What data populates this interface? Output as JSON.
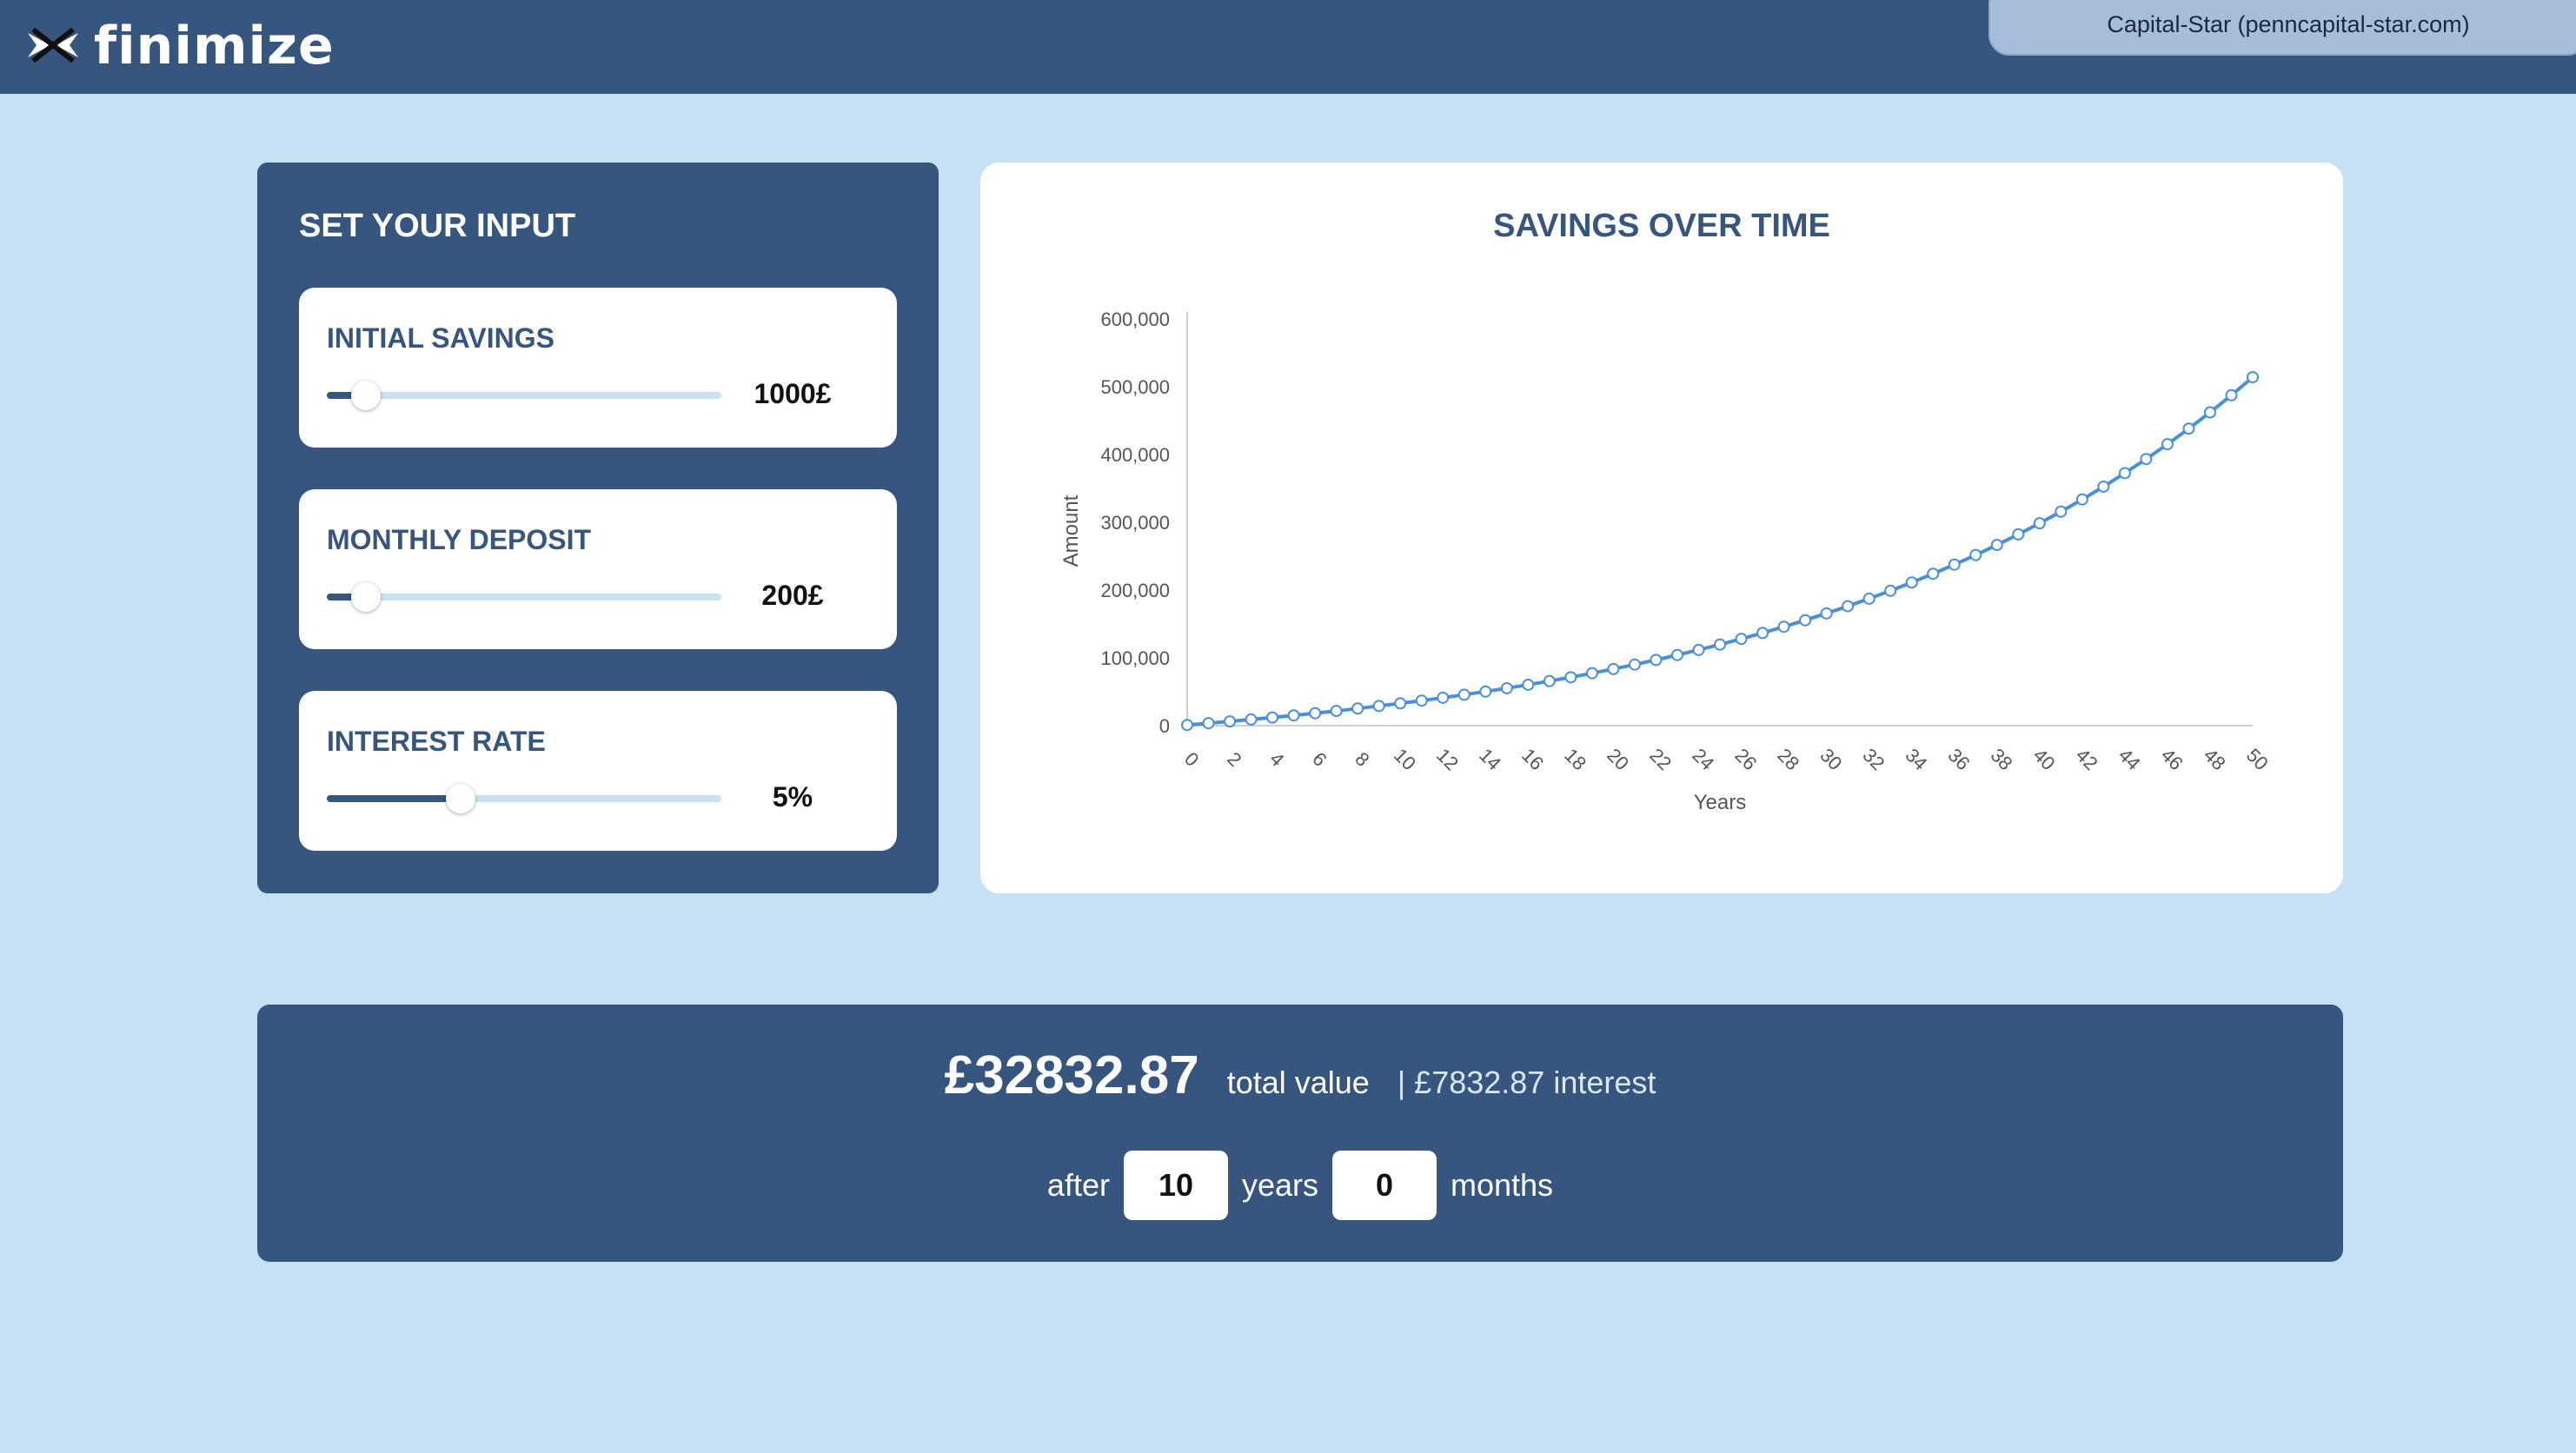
{
  "header": {
    "logo_text": "finimize",
    "logo_icon": "finimize-logo-icon",
    "notice_text": "Capital-Star (penncapital-star.com)"
  },
  "colors": {
    "header_bg": "#36557f",
    "page_bg": "#c6e1f5",
    "accent": "#36557f",
    "line": "#4a90d9"
  },
  "input_panel": {
    "title": "SET YOUR INPUT",
    "controls": [
      {
        "label": "INITIAL SAVINGS",
        "value": "1000£",
        "slider_fraction": 0.1
      },
      {
        "label": "MONTHLY DEPOSIT",
        "value": "200£",
        "slider_fraction": 0.1
      },
      {
        "label": "INTEREST RATE",
        "value": "5%",
        "slider_fraction": 0.34
      }
    ]
  },
  "chart_panel": {
    "title": "SAVINGS OVER TIME"
  },
  "chart_data": {
    "type": "line",
    "title": "SAVINGS OVER TIME",
    "xlabel": "Years",
    "ylabel": "Amount",
    "xlim": [
      0,
      50
    ],
    "ylim": [
      0,
      600000
    ],
    "x_ticks": [
      0,
      2,
      4,
      6,
      8,
      10,
      12,
      14,
      16,
      18,
      20,
      22,
      24,
      26,
      28,
      30,
      32,
      34,
      36,
      38,
      40,
      42,
      44,
      46,
      48,
      50
    ],
    "y_ticks": [
      0,
      100000,
      200000,
      300000,
      400000,
      500000,
      600000
    ],
    "y_tick_labels": [
      "0",
      "100,000",
      "200,000",
      "300,000",
      "400,000",
      "500,000",
      "600,000"
    ],
    "grid": false,
    "legend": "none",
    "x": [
      0,
      1,
      2,
      3,
      4,
      5,
      6,
      7,
      8,
      9,
      10,
      11,
      12,
      13,
      14,
      15,
      16,
      17,
      18,
      19,
      20,
      21,
      22,
      23,
      24,
      25,
      26,
      27,
      28,
      29,
      30,
      31,
      32,
      33,
      34,
      35,
      36,
      37,
      38,
      39,
      40,
      41,
      42,
      43,
      44,
      45,
      46,
      47,
      48,
      49,
      50
    ],
    "values": [
      1000,
      3570,
      6255,
      9069,
      12004,
      15084,
      18313,
      21697,
      25245,
      28964,
      32833,
      36894,
      41142,
      45607,
      50282,
      55186,
      60330,
      65727,
      71389,
      77330,
      83563,
      90103,
      96966,
      104167,
      111724,
      119655,
      127978,
      136713,
      145879,
      155498,
      165593,
      176187,
      187305,
      198974,
      211220,
      224072,
      237559,
      251714,
      266569,
      282159,
      298521,
      315692,
      333713,
      352625,
      372474,
      393304,
      415166,
      438109,
      462188,
      487459,
      513980
    ]
  },
  "summary": {
    "total_amount": "£32832.87",
    "total_label": "total value",
    "interest_label": "| £7832.87 interest",
    "after_label": "after",
    "years_value": "10",
    "years_label": "years",
    "months_value": "0",
    "months_label": "months"
  }
}
